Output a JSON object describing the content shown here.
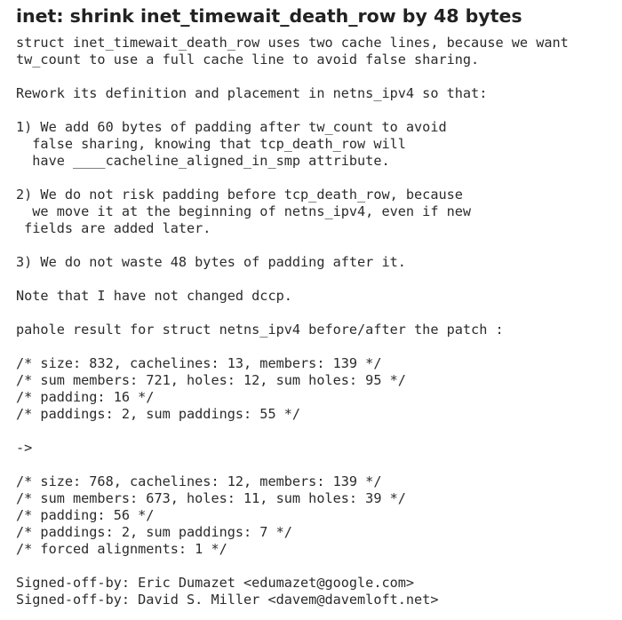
{
  "commit": {
    "title": "inet: shrink inet_timewait_death_row by 48 bytes",
    "body_lines": [
      "struct inet_timewait_death_row uses two cache lines, because we want",
      "tw_count to use a full cache line to avoid false sharing.",
      "",
      "Rework its definition and placement in netns_ipv4 so that:",
      "",
      "1) We add 60 bytes of padding after tw_count to avoid",
      "  false sharing, knowing that tcp_death_row will",
      "  have ____cacheline_aligned_in_smp attribute.",
      "",
      "2) We do not risk padding before tcp_death_row, because",
      "  we move it at the beginning of netns_ipv4, even if new",
      " fields are added later.",
      "",
      "3) We do not waste 48 bytes of padding after it.",
      "",
      "Note that I have not changed dccp.",
      "",
      "pahole result for struct netns_ipv4 before/after the patch :",
      "",
      "/* size: 832, cachelines: 13, members: 139 */",
      "/* sum members: 721, holes: 12, sum holes: 95 */",
      "/* padding: 16 */",
      "/* paddings: 2, sum paddings: 55 */",
      "",
      "->",
      "",
      "/* size: 768, cachelines: 12, members: 139 */",
      "/* sum members: 673, holes: 11, sum holes: 39 */",
      "/* padding: 56 */",
      "/* paddings: 2, sum paddings: 7 */",
      "/* forced alignments: 1 */",
      "",
      "Signed-off-by: Eric Dumazet <edumazet@google.com>",
      "Signed-off-by: David S. Miller <davem@davemloft.net>"
    ]
  }
}
